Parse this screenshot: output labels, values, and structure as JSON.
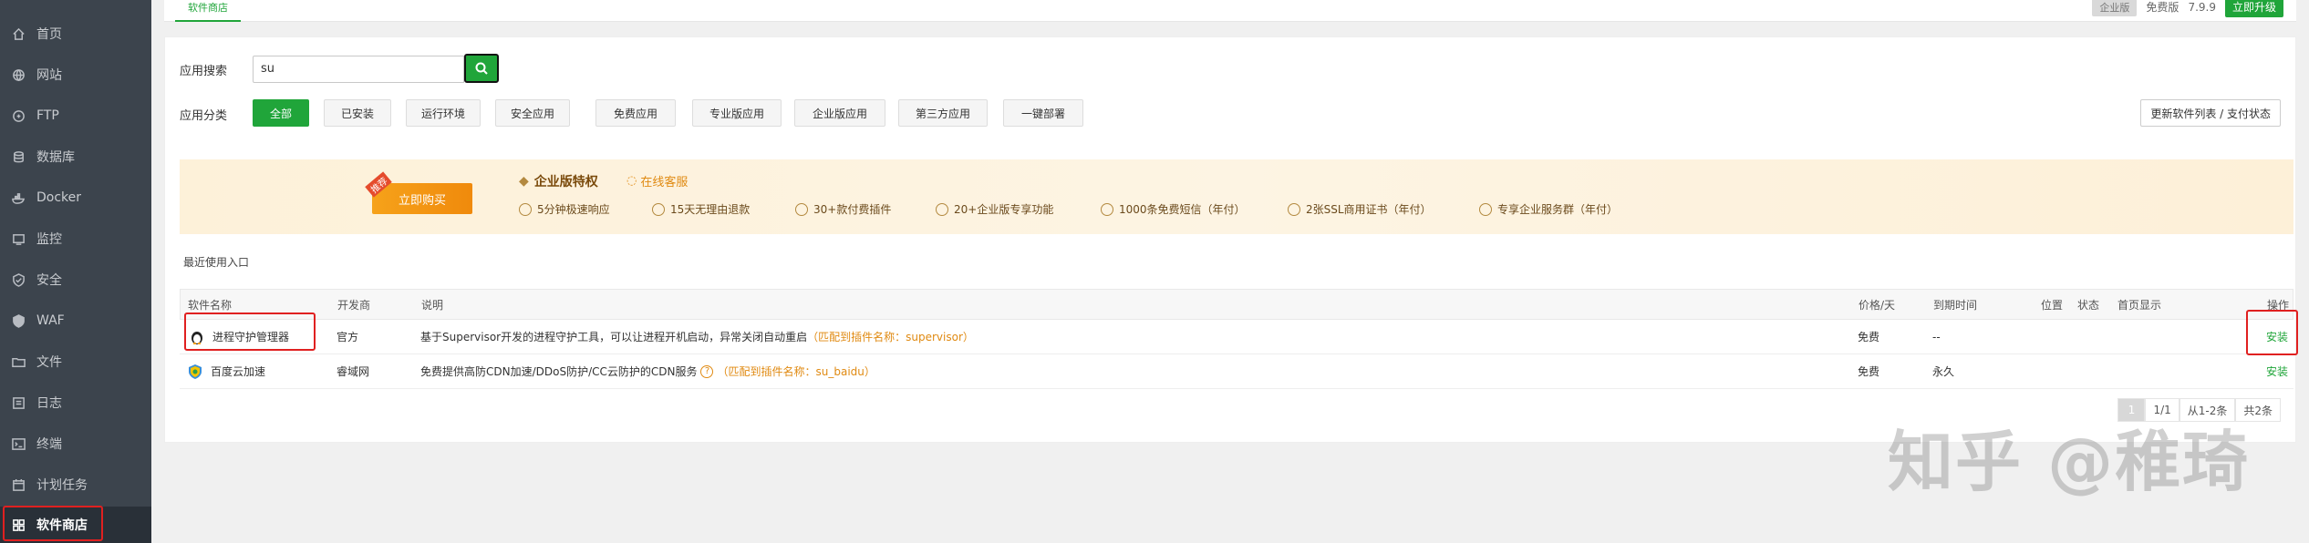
{
  "sidebar": {
    "items": [
      {
        "label": "首页",
        "icon": "home-icon"
      },
      {
        "label": "网站",
        "icon": "globe-icon"
      },
      {
        "label": "FTP",
        "icon": "ftp-icon"
      },
      {
        "label": "数据库",
        "icon": "database-icon"
      },
      {
        "label": "Docker",
        "icon": "docker-icon"
      },
      {
        "label": "监控",
        "icon": "monitor-icon"
      },
      {
        "label": "安全",
        "icon": "shield-icon"
      },
      {
        "label": "WAF",
        "icon": "waf-icon"
      },
      {
        "label": "文件",
        "icon": "folder-icon"
      },
      {
        "label": "日志",
        "icon": "log-icon"
      },
      {
        "label": "终端",
        "icon": "terminal-icon"
      },
      {
        "label": "计划任务",
        "icon": "calendar-icon"
      },
      {
        "label": "软件商店",
        "icon": "grid-icon",
        "active": true
      }
    ]
  },
  "topbar": {
    "tab_label": "软件商店",
    "edition_badge": "企业版",
    "free_label": "免费版",
    "version": "7.9.9",
    "upgrade_label": "立即升级"
  },
  "search": {
    "label": "应用搜索",
    "value": "su"
  },
  "categories": {
    "label": "应用分类",
    "items": [
      "全部",
      "已安装",
      "运行环境",
      "安全应用",
      "免费应用",
      "专业版应用",
      "企业版应用",
      "第三方应用",
      "一键部署"
    ],
    "active_index": 0,
    "refresh_label": "更新软件列表 / 支付状态"
  },
  "banner": {
    "buy_label": "立即购买",
    "buy_tag": "推荐",
    "title": "企业版特权",
    "online_service": "在线客服",
    "features": [
      "5分钟极速响应",
      "15天无理由退款",
      "30+款付费插件",
      "20+企业版专享功能",
      "1000条免费短信（年付）",
      "2张SSL商用证书（年付）",
      "专享企业服务群（年付）"
    ]
  },
  "recent_label": "最近使用入口",
  "table": {
    "headers": {
      "name": "软件名称",
      "developer": "开发商",
      "description": "说明",
      "price": "价格/天",
      "expiry": "到期时间",
      "location": "位置",
      "status": "状态",
      "homepage": "首页显示",
      "action": "操作"
    },
    "rows": [
      {
        "name": "进程守护管理器",
        "developer": "官方",
        "description": "基于Supervisor开发的进程守护工具，可以让进程开机启动，异常关闭自动重启",
        "match": "（匹配到插件名称：supervisor）",
        "price": "免费",
        "expiry": "--",
        "action": "安装"
      },
      {
        "name": "百度云加速",
        "developer": "睿域网",
        "description": "免费提供高防CDN加速/DDoS防护/CC云防护的CDN服务",
        "help": "?",
        "match": "（匹配到插件名称：su_baidu）",
        "price": "免费",
        "expiry": "永久",
        "action": "安装"
      }
    ]
  },
  "pagination": {
    "current": "1",
    "page_info": "1/1",
    "range": "从1-2条",
    "total": "共2条"
  },
  "watermark": "知乎 @稚琦",
  "colors": {
    "sidebar_bg": "#3c444d",
    "accent": "#20a53a",
    "highlight_box": "#e02020",
    "match_text": "#e08a12"
  }
}
